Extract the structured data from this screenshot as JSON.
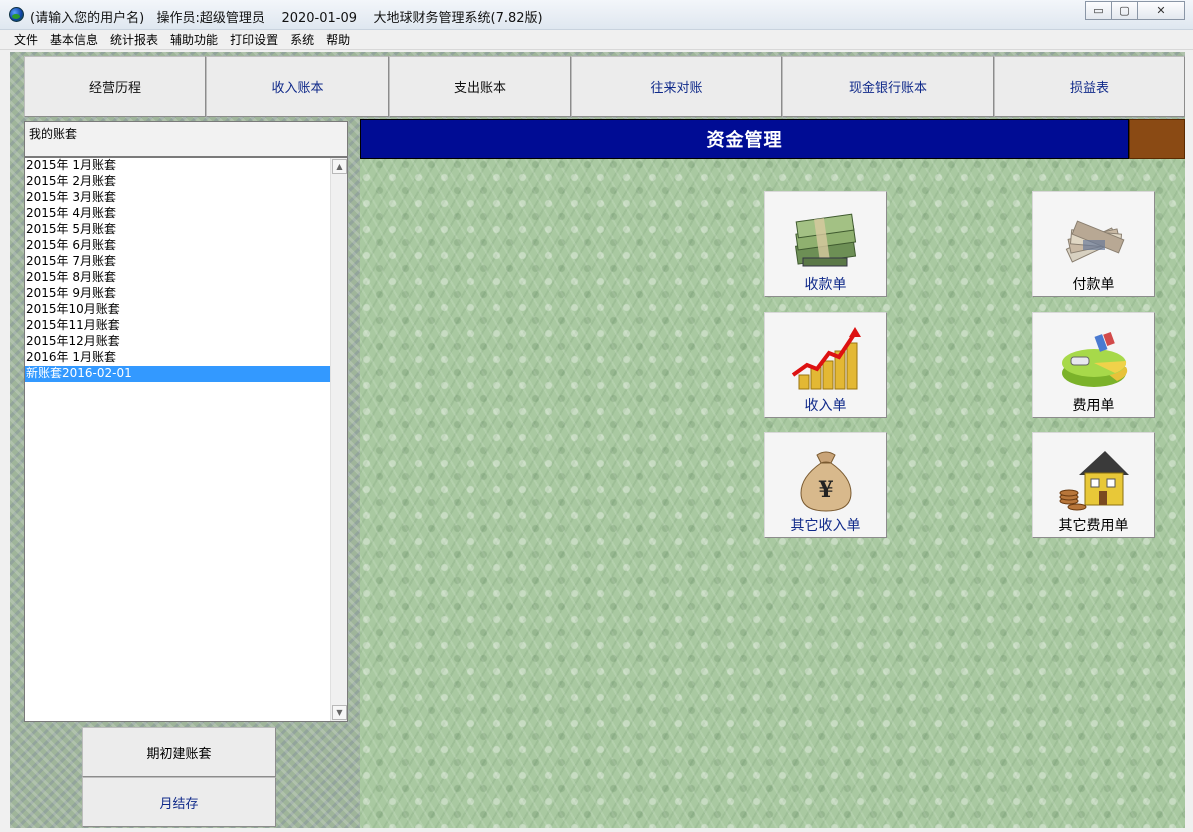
{
  "window": {
    "title": "(请输入您的用户名)   操作员:超级管理员    2020-01-09    大地球财务管理系统(7.82版)",
    "buttons": {
      "minimize": "▭",
      "maximize": "▢",
      "close": "✕"
    }
  },
  "menu": [
    "文件",
    "基本信息",
    "统计报表",
    "辅助功能",
    "打印设置",
    "系统",
    "帮助"
  ],
  "toolbar": [
    "经营历程",
    "收入账本",
    "支出账本",
    "往来对账",
    "现金银行账本",
    "损益表"
  ],
  "accounts": {
    "header": "我的账套",
    "items": [
      "2015年 1月账套",
      "2015年 2月账套",
      "2015年 3月账套",
      "2015年 4月账套",
      "2015年 5月账套",
      "2015年 6月账套",
      "2015年 7月账套",
      "2015年 8月账套",
      "2015年 9月账套",
      "2015年10月账套",
      "2015年11月账套",
      "2015年12月账套",
      "2016年 1月账套",
      "新账套2016-02-01"
    ],
    "selected_index": 13
  },
  "left_buttons": {
    "init": "期初建账套",
    "month_close": "月结存"
  },
  "main": {
    "title": "资金管理",
    "tiles": {
      "receipt": {
        "label": "收款单",
        "icon": "money-stack-icon"
      },
      "payment": {
        "label": "付款单",
        "icon": "banknotes-icon"
      },
      "income": {
        "label": "收入单",
        "icon": "rising-coins-icon"
      },
      "expense": {
        "label": "费用单",
        "icon": "pie-chart-icon"
      },
      "other_income": {
        "label": "其它收入单",
        "icon": "yuan-moneybag-icon"
      },
      "other_expense": {
        "label": "其它费用单",
        "icon": "house-coins-icon"
      }
    }
  },
  "colors": {
    "header_bg": "#000c94",
    "accent": "#8a4a14",
    "selection": "#3399ff",
    "main_bg": "#a9c9a1"
  }
}
